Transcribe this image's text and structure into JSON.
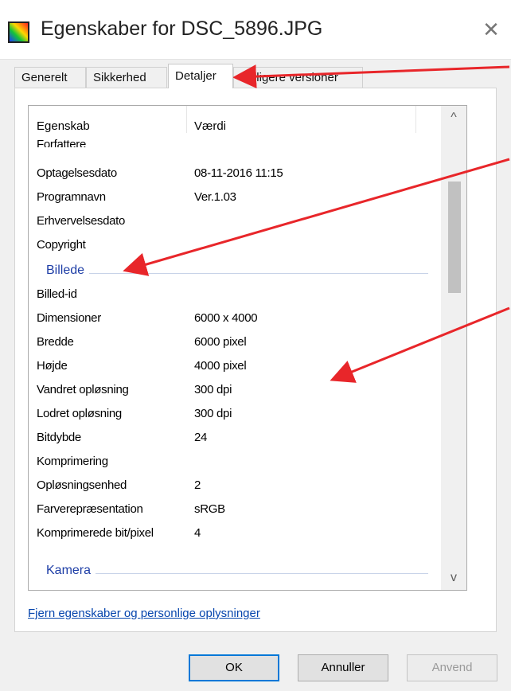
{
  "window": {
    "title": "Egenskaber for DSC_5896.JPG",
    "close_glyph": "✕"
  },
  "tabs": [
    {
      "label": "Generelt"
    },
    {
      "label": "Sikkerhed"
    },
    {
      "label": "Detaljer"
    },
    {
      "label": "Tidligere versioner"
    }
  ],
  "list": {
    "headers": {
      "property": "Egenskab",
      "value": "Værdi"
    },
    "partial_row": "Forfattere",
    "rows_before": [
      {
        "k": "Optagelsesdato",
        "v": "08-11-2016 11:15"
      },
      {
        "k": "Programnavn",
        "v": "Ver.1.03"
      },
      {
        "k": "Erhvervelsesdato",
        "v": ""
      },
      {
        "k": "Copyright",
        "v": ""
      }
    ],
    "group_image": "Billede",
    "rows_image": [
      {
        "k": "Billed-id",
        "v": ""
      },
      {
        "k": "Dimensioner",
        "v": "6000 x 4000"
      },
      {
        "k": "Bredde",
        "v": "6000 pixel"
      },
      {
        "k": "Højde",
        "v": "4000 pixel"
      },
      {
        "k": "Vandret opløsning",
        "v": "300 dpi"
      },
      {
        "k": "Lodret opløsning",
        "v": "300 dpi"
      },
      {
        "k": "Bitdybde",
        "v": "24"
      },
      {
        "k": "Komprimering",
        "v": ""
      },
      {
        "k": "Opløsningsenhed",
        "v": "2"
      },
      {
        "k": "Farverepræsentation",
        "v": "sRGB"
      },
      {
        "k": "Komprimerede bit/pixel",
        "v": "4"
      }
    ],
    "group_camera": "Kamera",
    "scroll_up": "^",
    "scroll_down": "v"
  },
  "remove_link": "Fjern egenskaber og personlige oplysninger",
  "buttons": {
    "ok": "OK",
    "cancel": "Annuller",
    "apply": "Anvend"
  },
  "colors": {
    "arrow": "#e8262a",
    "link": "#0645ad",
    "group_label": "#1e3ea6",
    "focus": "#0078d7"
  }
}
